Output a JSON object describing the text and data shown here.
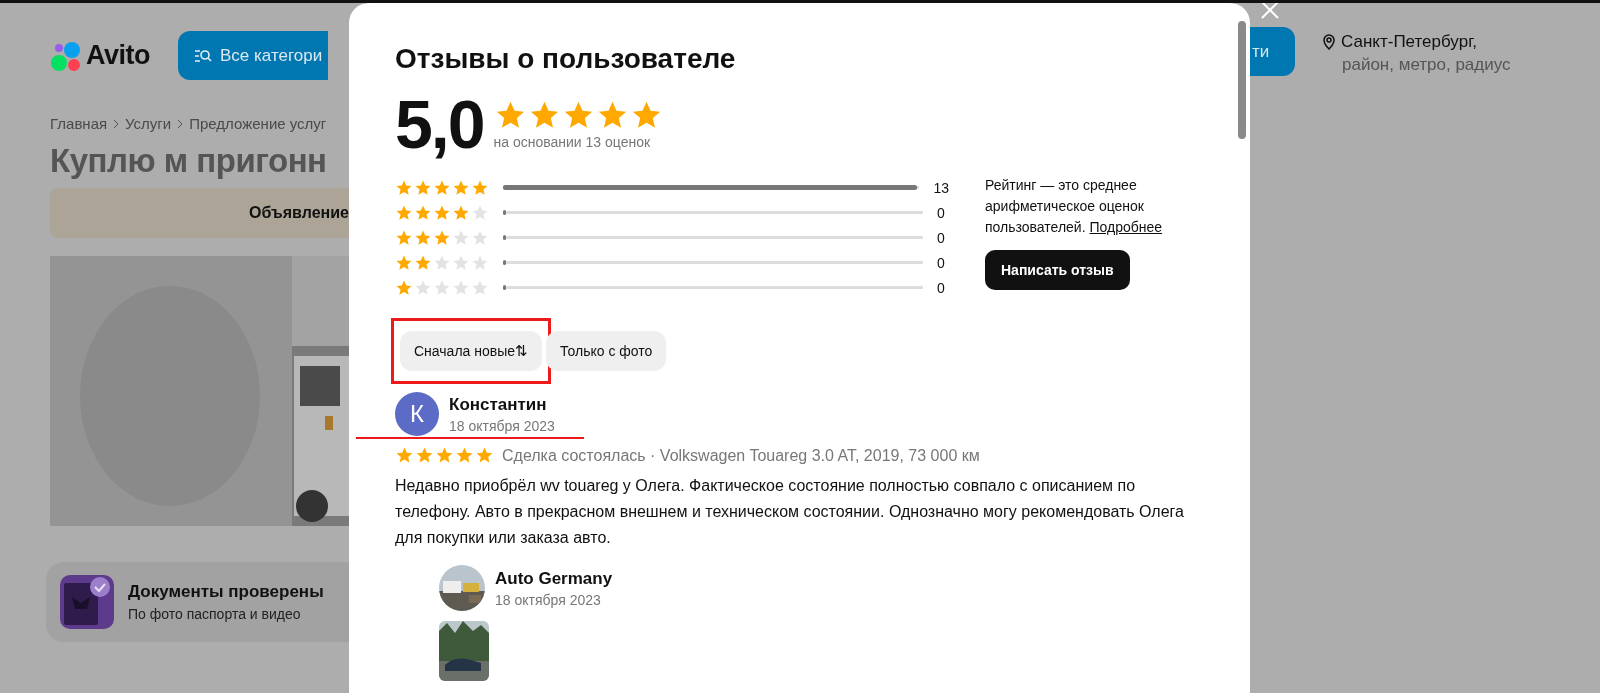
{
  "background_page": {
    "logo": "Avito",
    "categories_button": "Все категори",
    "search_button": "ти",
    "location": {
      "city": "Санкт-Петербург,",
      "hint": "район, метро, радиус"
    },
    "breadcrumbs": [
      "Главная",
      "Услуги",
      "Предложение услуг"
    ],
    "title": "Куплю м пригонн",
    "banner": "Объявление",
    "verification": {
      "title": "Документы проверены",
      "subtitle": "По фото паспорта и видео"
    }
  },
  "modal": {
    "title": "Отзывы о пользователе",
    "rating": "5,0",
    "stars": 5,
    "basis": "на основании 13 оценок",
    "histogram": [
      {
        "stars": 5,
        "level": 1,
        "count": "13"
      },
      {
        "stars": 4,
        "level": 0,
        "count": "0"
      },
      {
        "stars": 3,
        "level": 0,
        "count": "0"
      },
      {
        "stars": 2,
        "level": 0,
        "count": "0"
      },
      {
        "stars": 1,
        "level": 0,
        "count": "0"
      }
    ],
    "info": {
      "text": "Рейтинг — это среднее арифметическое оценок пользователей.",
      "link": "Подробнее"
    },
    "write_button": "Написать отзыв",
    "filters": [
      {
        "label": "Сначала новые",
        "icon": "⇅",
        "highlighted": true
      },
      {
        "label": "Только с фото",
        "highlighted": false
      }
    ],
    "reviews": [
      {
        "avatar_letter": "К",
        "author": "Константин",
        "date": "18 октября 2023",
        "underlined": true,
        "stars": 5,
        "deal": "Сделка состоялась · Volkswagen Touareg 3.0 AT, 2019, 73 000 км",
        "text": "Недавно приобрёл wv touareg у Олега. Фактическое состояние полностью совпало с описанием по телефону. Авто в прекрасном внешнем и техническом состоянии. Однозначно могу рекомендовать Олега для покупки или заказа авто.",
        "reply": {
          "author": "Auto Germany",
          "date": "18 октября 2023"
        }
      }
    ]
  }
}
